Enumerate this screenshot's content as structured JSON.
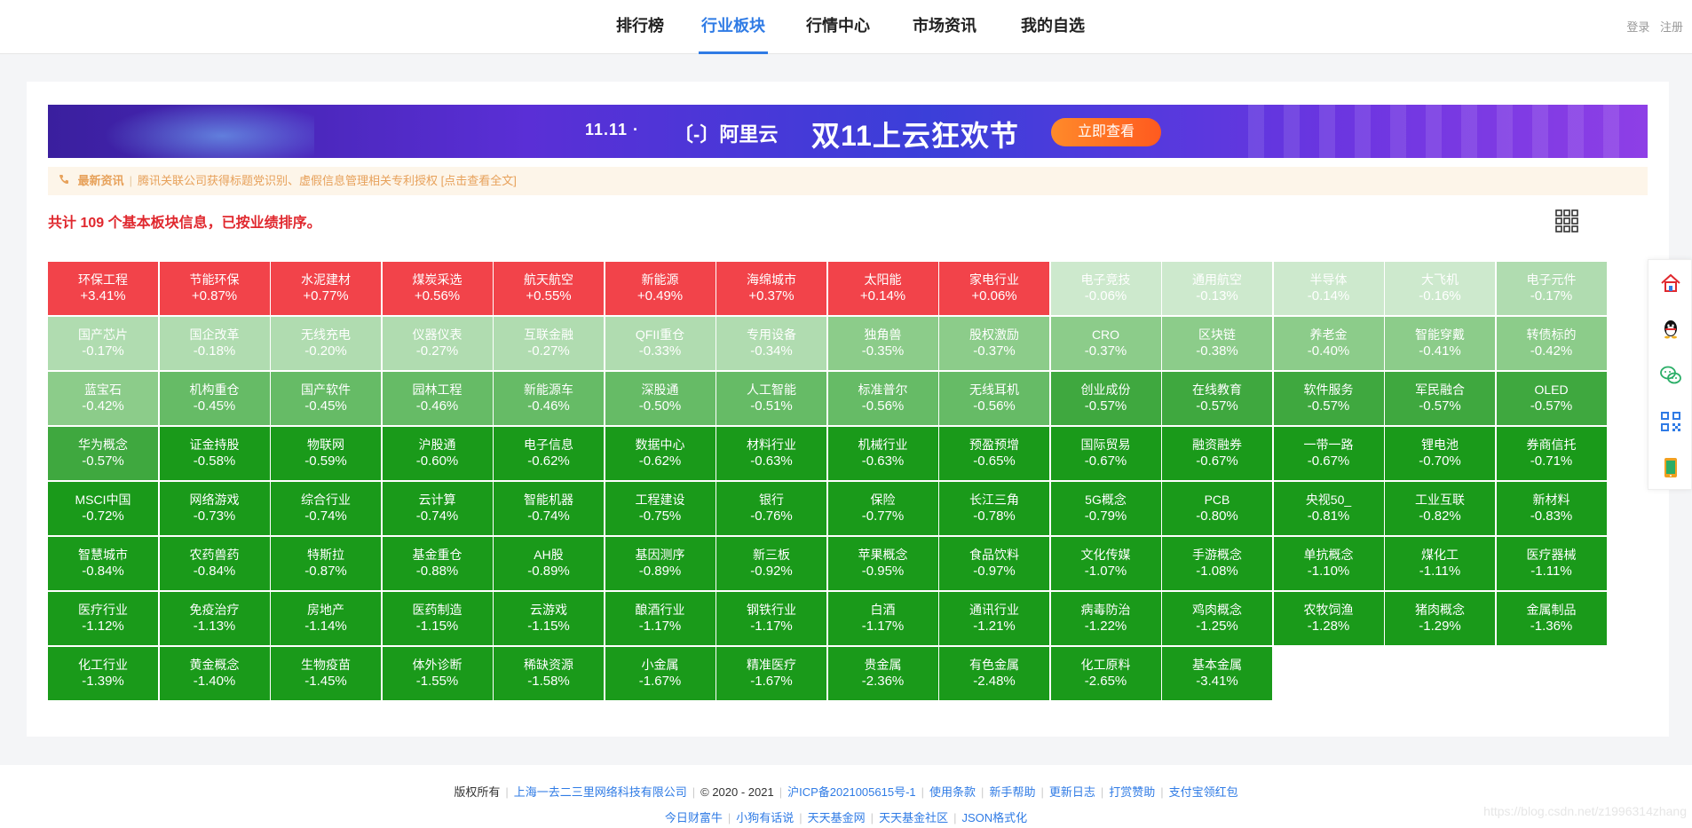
{
  "nav": {
    "items": [
      "排行榜",
      "行业板块",
      "行情中心",
      "市场资讯",
      "我的自选"
    ],
    "active_index": 1,
    "login": "登录",
    "register": "注册"
  },
  "banner": {
    "logo_text": "11.11 ·",
    "brand": "〔-〕阿里云",
    "slogan": "双11上云狂欢节",
    "cta": "立即查看"
  },
  "news": {
    "label": "最新资讯",
    "text": "腾讯关联公司获得标题党识别、虚假信息管理相关专利授权 [点击查看全文]"
  },
  "summary": "共计 109 个基本板块信息，已按业绩排序。",
  "colors": {
    "up": "#f2434a",
    "down_1": "#cde9cd",
    "down_2": "#b0dcb0",
    "down_3": "#8ccc8a",
    "down_4": "#66bb66",
    "down_5": "#3fa83f",
    "down_6": "#1a9a1a",
    "accent": "#2f7be5"
  },
  "sectors": [
    {
      "name": "环保工程",
      "change": "+3.41%"
    },
    {
      "name": "节能环保",
      "change": "+0.87%"
    },
    {
      "name": "水泥建材",
      "change": "+0.77%"
    },
    {
      "name": "煤炭采选",
      "change": "+0.56%"
    },
    {
      "name": "航天航空",
      "change": "+0.55%"
    },
    {
      "name": "新能源",
      "change": "+0.49%"
    },
    {
      "name": "海绵城市",
      "change": "+0.37%"
    },
    {
      "name": "太阳能",
      "change": "+0.14%"
    },
    {
      "name": "家电行业",
      "change": "+0.06%"
    },
    {
      "name": "电子竞技",
      "change": "-0.06%"
    },
    {
      "name": "通用航空",
      "change": "-0.13%"
    },
    {
      "name": "半导体",
      "change": "-0.14%"
    },
    {
      "name": "大飞机",
      "change": "-0.16%"
    },
    {
      "name": "电子元件",
      "change": "-0.17%"
    },
    {
      "name": "国产芯片",
      "change": "-0.17%"
    },
    {
      "name": "国企改革",
      "change": "-0.18%"
    },
    {
      "name": "无线充电",
      "change": "-0.20%"
    },
    {
      "name": "仪器仪表",
      "change": "-0.27%"
    },
    {
      "name": "互联金融",
      "change": "-0.27%"
    },
    {
      "name": "QFII重仓",
      "change": "-0.33%"
    },
    {
      "name": "专用设备",
      "change": "-0.34%"
    },
    {
      "name": "独角兽",
      "change": "-0.35%"
    },
    {
      "name": "股权激励",
      "change": "-0.37%"
    },
    {
      "name": "CRO",
      "change": "-0.37%"
    },
    {
      "name": "区块链",
      "change": "-0.38%"
    },
    {
      "name": "养老金",
      "change": "-0.40%"
    },
    {
      "name": "智能穿戴",
      "change": "-0.41%"
    },
    {
      "name": "转债标的",
      "change": "-0.42%"
    },
    {
      "name": "蓝宝石",
      "change": "-0.42%"
    },
    {
      "name": "机构重仓",
      "change": "-0.45%"
    },
    {
      "name": "国产软件",
      "change": "-0.45%"
    },
    {
      "name": "园林工程",
      "change": "-0.46%"
    },
    {
      "name": "新能源车",
      "change": "-0.46%"
    },
    {
      "name": "深股通",
      "change": "-0.50%"
    },
    {
      "name": "人工智能",
      "change": "-0.51%"
    },
    {
      "name": "标准普尔",
      "change": "-0.56%"
    },
    {
      "name": "无线耳机",
      "change": "-0.56%"
    },
    {
      "name": "创业成份",
      "change": "-0.57%"
    },
    {
      "name": "在线教育",
      "change": "-0.57%"
    },
    {
      "name": "软件服务",
      "change": "-0.57%"
    },
    {
      "name": "军民融合",
      "change": "-0.57%"
    },
    {
      "name": "OLED",
      "change": "-0.57%"
    },
    {
      "name": "华为概念",
      "change": "-0.57%"
    },
    {
      "name": "证金持股",
      "change": "-0.58%"
    },
    {
      "name": "物联网",
      "change": "-0.59%"
    },
    {
      "name": "沪股通",
      "change": "-0.60%"
    },
    {
      "name": "电子信息",
      "change": "-0.62%"
    },
    {
      "name": "数据中心",
      "change": "-0.62%"
    },
    {
      "name": "材料行业",
      "change": "-0.63%"
    },
    {
      "name": "机械行业",
      "change": "-0.63%"
    },
    {
      "name": "预盈预增",
      "change": "-0.65%"
    },
    {
      "name": "国际贸易",
      "change": "-0.67%"
    },
    {
      "name": "融资融券",
      "change": "-0.67%"
    },
    {
      "name": "一带一路",
      "change": "-0.67%"
    },
    {
      "name": "锂电池",
      "change": "-0.70%"
    },
    {
      "name": "券商信托",
      "change": "-0.71%"
    },
    {
      "name": "MSCI中国",
      "change": "-0.72%"
    },
    {
      "name": "网络游戏",
      "change": "-0.73%"
    },
    {
      "name": "综合行业",
      "change": "-0.74%"
    },
    {
      "name": "云计算",
      "change": "-0.74%"
    },
    {
      "name": "智能机器",
      "change": "-0.74%"
    },
    {
      "name": "工程建设",
      "change": "-0.75%"
    },
    {
      "name": "银行",
      "change": "-0.76%"
    },
    {
      "name": "保险",
      "change": "-0.77%"
    },
    {
      "name": "长江三角",
      "change": "-0.78%"
    },
    {
      "name": "5G概念",
      "change": "-0.79%"
    },
    {
      "name": "PCB",
      "change": "-0.80%"
    },
    {
      "name": "央视50_",
      "change": "-0.81%"
    },
    {
      "name": "工业互联",
      "change": "-0.82%"
    },
    {
      "name": "新材料",
      "change": "-0.83%"
    },
    {
      "name": "智慧城市",
      "change": "-0.84%"
    },
    {
      "name": "农药兽药",
      "change": "-0.84%"
    },
    {
      "name": "特斯拉",
      "change": "-0.87%"
    },
    {
      "name": "基金重仓",
      "change": "-0.88%"
    },
    {
      "name": "AH股",
      "change": "-0.89%"
    },
    {
      "name": "基因测序",
      "change": "-0.89%"
    },
    {
      "name": "新三板",
      "change": "-0.92%"
    },
    {
      "name": "苹果概念",
      "change": "-0.95%"
    },
    {
      "name": "食品饮料",
      "change": "-0.97%"
    },
    {
      "name": "文化传媒",
      "change": "-1.07%"
    },
    {
      "name": "手游概念",
      "change": "-1.08%"
    },
    {
      "name": "单抗概念",
      "change": "-1.10%"
    },
    {
      "name": "煤化工",
      "change": "-1.11%"
    },
    {
      "name": "医疗器械",
      "change": "-1.11%"
    },
    {
      "name": "医疗行业",
      "change": "-1.12%"
    },
    {
      "name": "免疫治疗",
      "change": "-1.13%"
    },
    {
      "name": "房地产",
      "change": "-1.14%"
    },
    {
      "name": "医药制造",
      "change": "-1.15%"
    },
    {
      "name": "云游戏",
      "change": "-1.15%"
    },
    {
      "name": "酿酒行业",
      "change": "-1.17%"
    },
    {
      "name": "钢铁行业",
      "change": "-1.17%"
    },
    {
      "name": "白酒",
      "change": "-1.17%"
    },
    {
      "name": "通讯行业",
      "change": "-1.21%"
    },
    {
      "name": "病毒防治",
      "change": "-1.22%"
    },
    {
      "name": "鸡肉概念",
      "change": "-1.25%"
    },
    {
      "name": "农牧饲渔",
      "change": "-1.28%"
    },
    {
      "name": "猪肉概念",
      "change": "-1.29%"
    },
    {
      "name": "金属制品",
      "change": "-1.36%"
    },
    {
      "name": "化工行业",
      "change": "-1.39%"
    },
    {
      "name": "黄金概念",
      "change": "-1.40%"
    },
    {
      "name": "生物疫苗",
      "change": "-1.45%"
    },
    {
      "name": "体外诊断",
      "change": "-1.55%"
    },
    {
      "name": "稀缺资源",
      "change": "-1.58%"
    },
    {
      "name": "小金属",
      "change": "-1.67%"
    },
    {
      "name": "精准医疗",
      "change": "-1.67%"
    },
    {
      "name": "贵金属",
      "change": "-2.36%"
    },
    {
      "name": "有色金属",
      "change": "-2.48%"
    },
    {
      "name": "化工原料",
      "change": "-2.65%"
    },
    {
      "name": "基本金属",
      "change": "-3.41%"
    }
  ],
  "sidetools": [
    "home-icon",
    "qq-icon",
    "wechat-icon",
    "qrcode-icon",
    "mobile-icon"
  ],
  "footer": {
    "copyright_label": "版权所有",
    "company": "上海一去二三里网络科技有限公司",
    "years": "© 2020 - 2021",
    "icp": "沪ICP备2021005615号-1",
    "links_row1": [
      "使用条款",
      "新手帮助",
      "更新日志",
      "打赏赞助",
      "支付宝领红包"
    ],
    "links_row2": [
      "今日财富牛",
      "小狗有话说",
      "天天基金网",
      "天天基金社区",
      "JSON格式化"
    ]
  },
  "watermark": "https://blog.csdn.net/z1996314zhang"
}
